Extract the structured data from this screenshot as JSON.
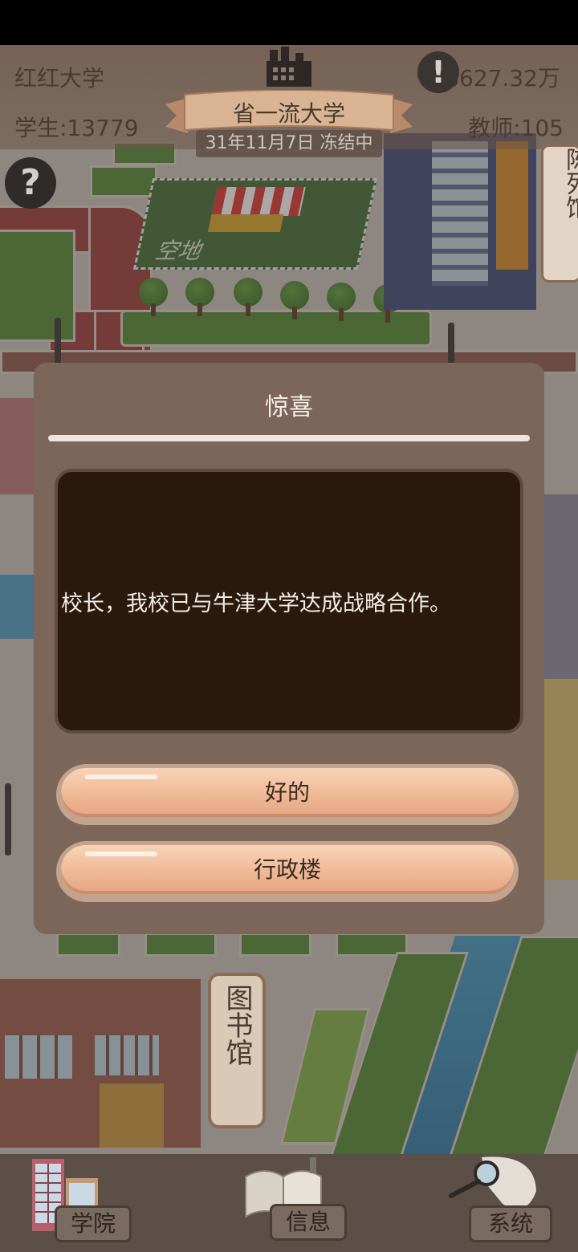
{
  "hud": {
    "school_name": "红红大学",
    "money": "8627.32万",
    "students": "学生:13779",
    "teachers": "教师:105",
    "rank_title": "省一流大学",
    "date_status": "31年11月7日 冻结中",
    "alert_icon": "exclamation-icon",
    "help_icon": "question-icon"
  },
  "map": {
    "empty_lot_label": "空地",
    "sign_right": "陈列馆",
    "sign_library": "图书馆"
  },
  "dialog": {
    "title": "惊喜",
    "message": "校长，我校已与牛津大学达成战略合作。",
    "ok_label": "好的",
    "admin_label": "行政楼"
  },
  "nav": {
    "college": "学院",
    "info": "信息",
    "system": "系统"
  }
}
